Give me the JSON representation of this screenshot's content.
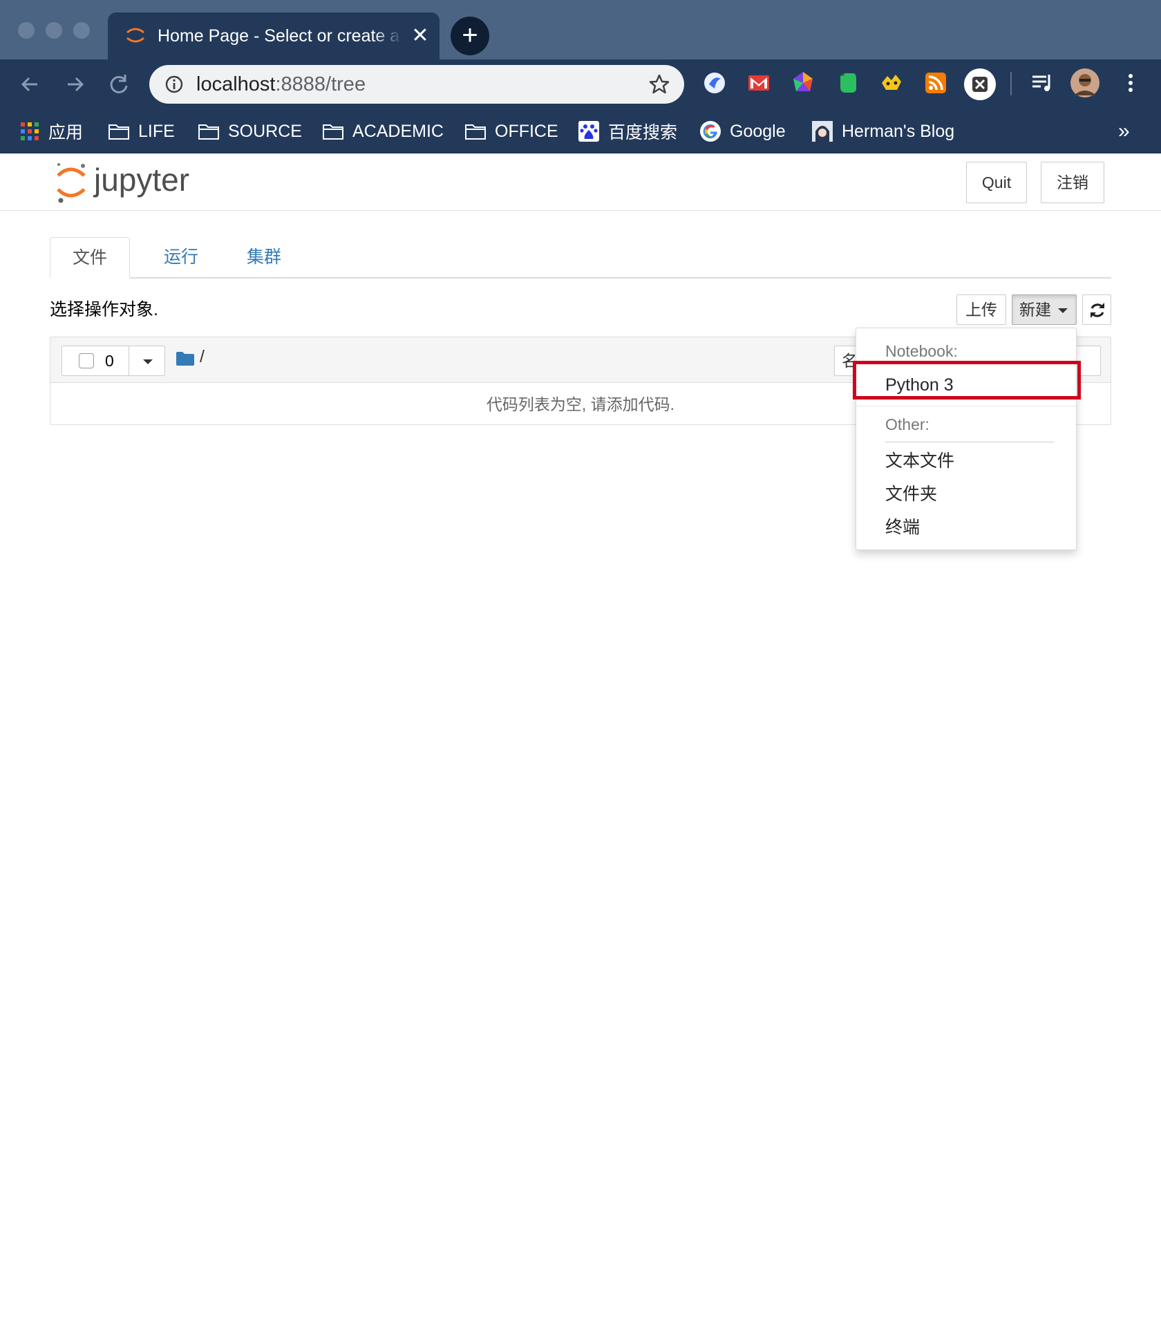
{
  "browser": {
    "tab_title": "Home Page - Select or create a notebook",
    "tab_close": "✕",
    "new_tab": "+",
    "url_host": "localhost",
    "url_rest": ":8888/tree",
    "bookmarks": [
      {
        "label": "应用",
        "icon": "apps-grid-icon"
      },
      {
        "label": "LIFE",
        "icon": "folder-icon"
      },
      {
        "label": "SOURCE",
        "icon": "folder-icon"
      },
      {
        "label": "ACADEMIC",
        "icon": "folder-icon"
      },
      {
        "label": "OFFICE",
        "icon": "folder-icon"
      },
      {
        "label": "百度搜索",
        "icon": "baidu-icon"
      },
      {
        "label": "Google",
        "icon": "google-icon"
      },
      {
        "label": "Herman's Blog",
        "icon": "blog-avatar-icon"
      }
    ],
    "bookmarks_more": "»",
    "colors": {
      "frame": "#4c6483",
      "toolbar": "#23395a"
    }
  },
  "jupyter": {
    "logo_text": "jupyter",
    "quit_label": "Quit",
    "logout_label": "注销",
    "tabs": [
      {
        "label": "文件",
        "active": true
      },
      {
        "label": "运行",
        "active": false
      },
      {
        "label": "集群",
        "active": false
      }
    ],
    "hint": "选择操作对象.",
    "upload_label": "上传",
    "new_label": "新建",
    "selected_count": "0",
    "breadcrumb": "/",
    "sort_label": "名",
    "empty_message": "代码列表为空, 请添加代码.",
    "accent": "#f37726",
    "link_color": "#337ab7"
  },
  "new_menu": {
    "notebook_header": "Notebook:",
    "notebook_items": [
      "Python 3"
    ],
    "other_header": "Other:",
    "other_items": [
      "文本文件",
      "文件夹",
      "终端"
    ],
    "highlighted_item": "Python 3",
    "highlight_color": "#d0021b"
  }
}
